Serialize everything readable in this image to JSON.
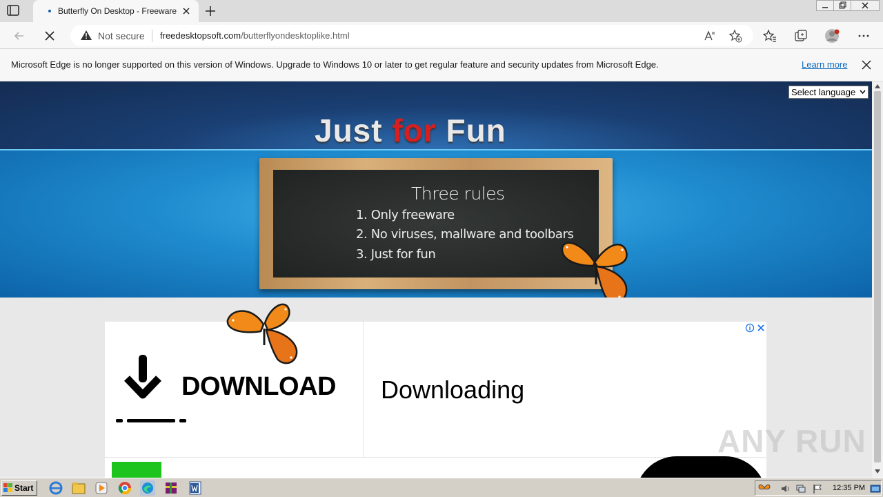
{
  "browser": {
    "tab": {
      "title": "Butterfly On Desktop - Freeware and"
    },
    "address": {
      "security_label": "Not secure",
      "url_host": "freedesktopsoft.com",
      "url_path": "/butterflyondesktoplike.html"
    },
    "infobar": {
      "message": "Microsoft Edge is no longer supported on this version of Windows. Upgrade to Windows 10 or later to get regular feature and security updates from Microsoft Edge.",
      "link_label": "Learn more"
    }
  },
  "page": {
    "language_select": {
      "selected": "Select language"
    },
    "brand": {
      "word1": "Just",
      "word2": "for",
      "word3": "Fun"
    },
    "chalkboard": {
      "title": "Three rules",
      "rules": [
        "1. Only freeware",
        "2. No viruses, mallware and toolbars",
        "3. Just for fun"
      ]
    },
    "ad": {
      "download_label": "DOWNLOAD",
      "headline": "Downloading"
    },
    "watermark": "ANY RUN"
  },
  "taskbar": {
    "start_label": "Start",
    "clock": "12:35 PM"
  },
  "colors": {
    "brand_red": "#d81f1f",
    "link_blue": "#0f6cbd",
    "board": "#262a29",
    "ad_green": "#1ec41e"
  }
}
